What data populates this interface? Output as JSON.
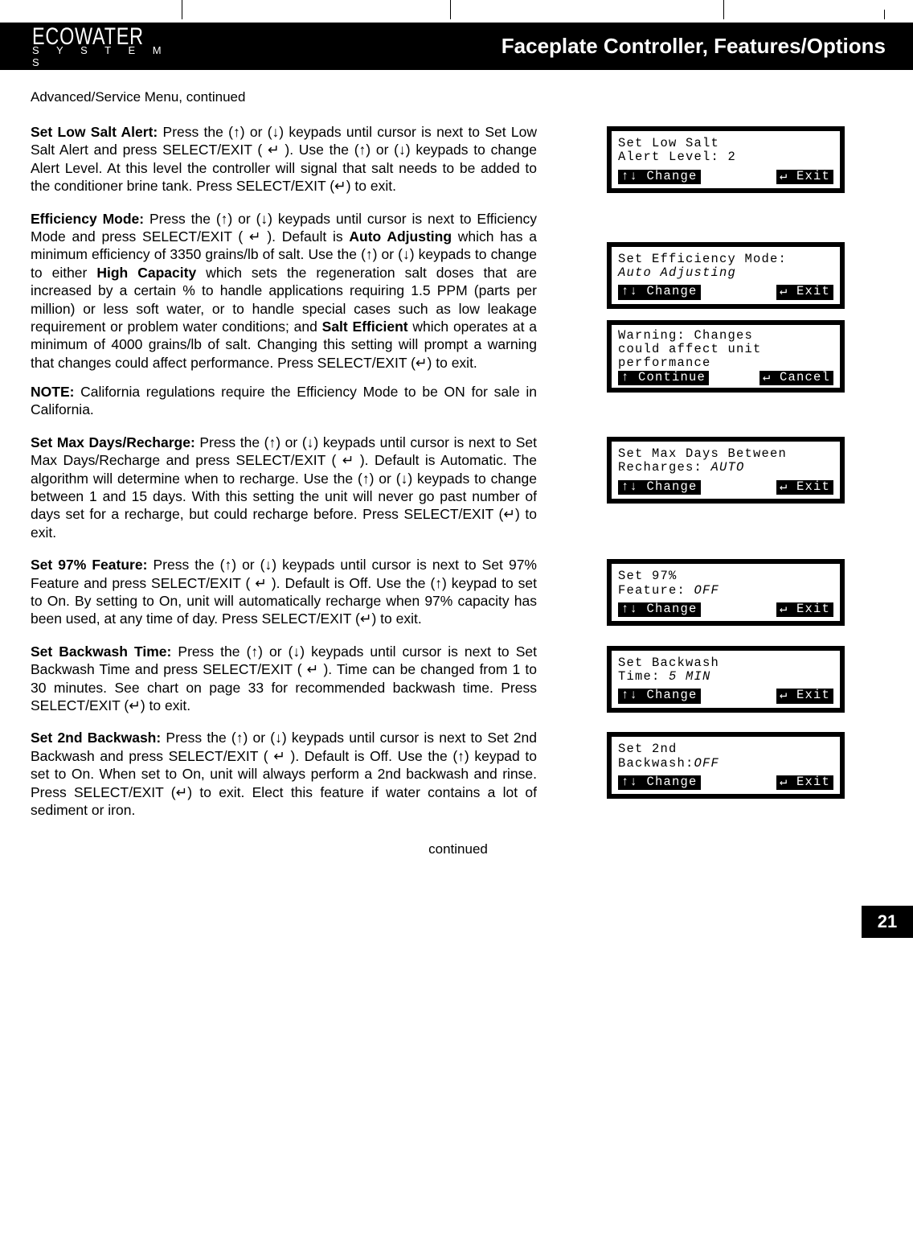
{
  "header": {
    "brand": "ECOWATER",
    "brand_sub": "S Y S T E M S",
    "title": "Faceplate Controller, Features/Options"
  },
  "subhead": "Advanced/Service Menu, continued",
  "sections": {
    "lowsalt": {
      "lead": "Set Low Salt Alert:",
      "body": " Press the (↑) or (↓) keypads until cursor is next to Set Low Salt Alert and press SELECT/EXIT ( ↵ ).  Use the (↑) or (↓) keypads to change Alert Level.  At this level the controller will signal that salt needs to be added to the conditioner brine tank.  Press SELECT/EXIT (↵) to exit.",
      "lcd": {
        "l1": "Set Low Salt",
        "l2_label": "Alert Level: ",
        "l2_value": "2",
        "foot_l": "Change",
        "foot_r": "Exit"
      }
    },
    "effmode": {
      "lead": "Efficiency Mode:",
      "body1": " Press the (↑) or (↓) keypads until cursor is next to Efficiency Mode and press SELECT/EXIT ( ↵ ).  Default is ",
      "bold1": "Auto Adjusting",
      "body2": " which has a minimum efficiency of 3350 grains/lb of salt. Use the (↑) or (↓) keypads to change to either ",
      "bold2": "High Capacity",
      "body3": " which sets the regeneration salt doses that are increased by a certain % to handle applications requiring 1.5 PPM (parts per million) or less soft water, or to handle special cases such as low leakage requirement or problem water conditions; and ",
      "bold3": "Salt Efficient",
      "body4": " which operates at a minimum of 4000 grains/lb of salt.  Changing this setting will prompt a warning that changes could affect performance. Press SELECT/EXIT (↵) to exit.",
      "note_lead": "NOTE:",
      "note_body": " California regulations require the Efficiency Mode to be ON for sale in California.",
      "lcd": {
        "l1": "Set Efficiency Mode:",
        "l2": "Auto Adjusting",
        "foot_l": "Change",
        "foot_r": "Exit"
      },
      "lcd2": {
        "l1": "Warning: Changes",
        "l2": "could affect unit",
        "l3": "performance",
        "foot_l": "Continue",
        "foot_r": "Cancel"
      }
    },
    "maxdays": {
      "lead": "Set Max Days/Recharge:",
      "body": " Press the (↑) or (↓) keypads until cursor is next to Set Max Days/Recharge and press SELECT/EXIT ( ↵ ).  Default is Automatic.  The algorithm will determine when to recharge. Use the (↑) or (↓) keypads to change between 1 and 15 days.  With this setting the unit will never go past number of days set for a recharge, but could recharge before.  Press SELECT/EXIT (↵) to exit.",
      "lcd": {
        "l1": "Set Max Days Between",
        "l2_label": "Recharges: ",
        "l2_value": "AUTO",
        "foot_l": "Change",
        "foot_r": "Exit"
      }
    },
    "pct97": {
      "lead": "Set 97% Feature:",
      "body": " Press the (↑) or (↓) keypads until cursor is next to Set 97% Feature and press SELECT/EXIT ( ↵ ). Default is Off. Use the (↑) keypad to set to On.  By setting to On, unit will automatically recharge when 97% capacity has been used, at any time of day. Press SELECT/EXIT (↵) to exit.",
      "lcd": {
        "l1": "Set 97%",
        "l2_label": "Feature: ",
        "l2_value": "OFF",
        "foot_l": "Change",
        "foot_r": "Exit"
      }
    },
    "backwash": {
      "lead": "Set Backwash Time:",
      "body": " Press the (↑) or (↓) keypads until cursor is next to Set Backwash Time and press SELECT/EXIT ( ↵ ).  Time can be changed from 1 to 30 minutes.  See chart on page 33 for recommended backwash time.  Press SELECT/EXIT (↵) to exit.",
      "lcd": {
        "l1": "Set Backwash",
        "l2_label": "Time: ",
        "l2_value": "5 MIN",
        "foot_l": "Change",
        "foot_r": "Exit"
      }
    },
    "backwash2": {
      "lead": "Set 2nd Backwash:",
      "body": "  Press the (↑) or (↓) keypads until cursor is next to Set 2nd Backwash and press SELECT/EXIT ( ↵ ).  Default is Off. Use the (↑) keypad to set to On.  When set to On, unit will always perform a 2nd backwash and rinse.  Press SELECT/EXIT (↵) to exit. Elect this feature if water contains a lot of sediment or iron.",
      "lcd": {
        "l1": "Set 2nd",
        "l2_label": "Backwash:",
        "l2_value": "OFF",
        "foot_l": "Change",
        "foot_r": "Exit"
      }
    }
  },
  "continued": "continued",
  "page_number": "21"
}
